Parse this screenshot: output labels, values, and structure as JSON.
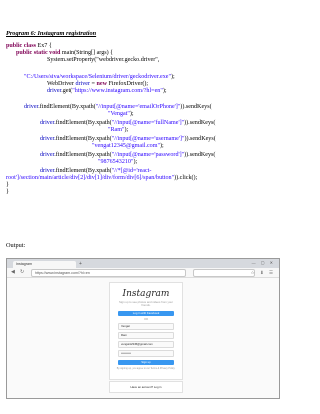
{
  "heading": "Program 6: Instagram registration",
  "code": {
    "class_decl": {
      "kw": "public class",
      "rest": " Ex7 {"
    },
    "main_decl": {
      "kw": "public static void",
      "rest": " main(String[] args) {"
    },
    "set_property": "System.setProperty(\"webdriver.gecko.driver\",",
    "driver_path": {
      "str": "\"C:/Users/siva/workspace/Selenium/driver/geckodriver.exe\"",
      "rest": ");"
    },
    "webdriver": {
      "type": "WebDriver ",
      "var": "driver",
      "mid": " = ",
      "kw": "new",
      "rest": " FirefoxDriver();"
    },
    "get": {
      "var": "driver",
      "mid": ".get(",
      "str": "\"https://www.instagram.com/?hl=en\"",
      "rest": ");"
    },
    "find1": {
      "var": "driver",
      "mid": ".findElement(By.xpath(",
      "str": "\"//input[@name='emailOrPhone']\"",
      "rest": ")).sendKeys("
    },
    "find1_arg": {
      "str": "\"Vengat\"",
      "rest": ");"
    },
    "find2": {
      "var": "driver",
      "mid": ".findElement(By.xpath(",
      "str": "\"//input[@name='fullName']\"",
      "rest": ")).sendKeys("
    },
    "find2_arg": {
      "str": "\"Ram\"",
      "rest": ");"
    },
    "find3": {
      "var": "driver",
      "mid": ".findElement(By.xpath(",
      "str": "\"//input[@name='username']\"",
      "rest": ")).sendKeys("
    },
    "find3_arg": {
      "str": "\"vengat12345@gmail.com\"",
      "rest": ");"
    },
    "find4": {
      "var": "driver",
      "mid": ".findElement(By.xpath(",
      "str": "\"//input[@name='password']\"",
      "rest": ")).sendKeys("
    },
    "find4_arg": {
      "str": "\"9876543210\"",
      "rest": ");"
    },
    "find5": {
      "var": "driver",
      "mid": ".findElement(By.xpath(",
      "str": "\"//*[@id='react-",
      "rest": ""
    },
    "find5_cont": {
      "str": "root']/section/main/article/div[2]/div[1]/div/form/div[6]/span/button\"",
      "rest": ")).click();"
    },
    "close_inner": "}",
    "close_outer": "}"
  },
  "output_label": "Output:",
  "screenshot": {
    "tab_title": "Instagram",
    "url": "https://www.instagram.com/?hl=en",
    "logo": "Instagram",
    "tagline": "Sign up to see photos and videos from your friends.",
    "facebook_button": "Log in with Facebook",
    "or": "OR",
    "fields": [
      "Vengat",
      "Ram",
      "vengat12345@gmail.com",
      "••••••••••"
    ],
    "signup_button": "Sign up",
    "terms": "By signing up, you agree to our Terms & Privacy Policy.",
    "have_account": "Have an account? Log in"
  },
  "colors": {
    "keyword": "#7f0055",
    "string": "#2a00ff",
    "field": "#0000c0",
    "instagram_blue": "#3897f0"
  }
}
